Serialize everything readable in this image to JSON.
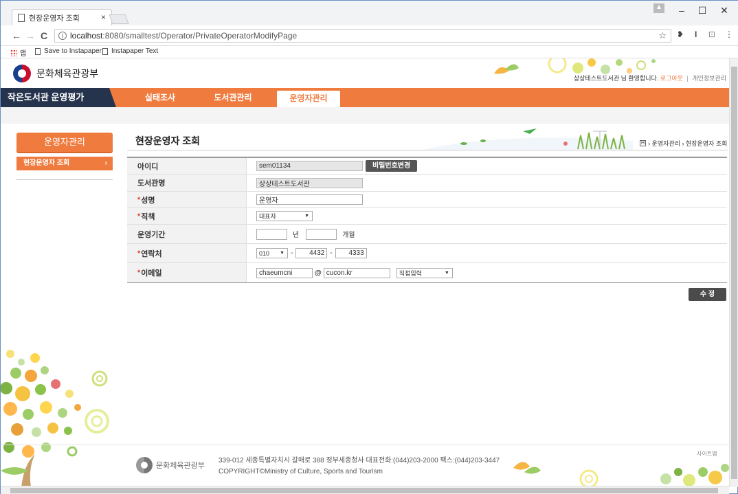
{
  "browser": {
    "tab_title": "현장운영자 조회",
    "tab_close": "×",
    "url_host": "localhost",
    "url_rest": ":8080/smalltest/Operator/PrivateOperatorModifyPage",
    "info_glyph": "i",
    "star_glyph": "☆",
    "back": "←",
    "forward": "→",
    "reload": "C",
    "minimize": "–",
    "maximize": "☐",
    "close": "✕",
    "ext_glyphs": [
      "❥",
      "I",
      "⊡",
      "⋮"
    ],
    "bookmarks": [
      {
        "label": "앱",
        "icon": "apps-icon"
      },
      {
        "label": "Save to Instapaper",
        "icon": "page-icon"
      },
      {
        "label": "Instapaper Text",
        "icon": "page-icon"
      }
    ]
  },
  "site": {
    "logo_text": "문화체육관광부",
    "user_greeting": "상상테스트도서관 님 환영합니다.",
    "logout": "로그아웃",
    "separator": "|",
    "privacy": "개인정보관리"
  },
  "gnb": {
    "brand": "작은도서관 운영평가",
    "items": [
      "실태조사",
      "도서관관리",
      "운영자관리"
    ],
    "active_index": 2
  },
  "lnb": {
    "title": "운영자관리",
    "items": [
      {
        "label": "현장운영자 조회",
        "arrow": "›"
      }
    ]
  },
  "content": {
    "title": "현장운영자 조회",
    "breadcrumb": {
      "home": "H",
      "path": "› 운영자관리 › 현장운영자 조회"
    }
  },
  "form": {
    "id_label": "아이디",
    "id_value": "sem01134",
    "password_button": "비밀번호변경",
    "library_label": "도서관명",
    "library_value": "상상테스트도서관",
    "name_label": "성명",
    "name_value": "운영자",
    "position_label": "직책",
    "position_value": "대표자",
    "period_label": "운영기간",
    "period_year_value": "",
    "period_year_unit": "년",
    "period_month_value": "",
    "period_month_unit": "개월",
    "phone_label": "연락처",
    "phone_prefix": "010",
    "phone_middle": "4432",
    "phone_last": "4333",
    "phone_dash": "-",
    "email_label": "이메일",
    "email_id": "chaeumcni",
    "email_at": "@",
    "email_domain": "cucon.kr",
    "email_select": "직접입력",
    "required_mark": "*",
    "caret": "▼",
    "submit": "수 정"
  },
  "footer": {
    "logo_text": "문화체육관광부",
    "address": "339-012 세종특별자치시 갈매로 388 정부세종청사 대표전화:(044)203-2000 팩스:(044)203-3447",
    "copyright": "COPYRIGHT©Ministry of Culture, Sports and Tourism",
    "sitemap": "사이트맵"
  },
  "colors": {
    "accent": "#f07b3f",
    "brand_dark": "#26334d",
    "required": "#e23c2c"
  }
}
